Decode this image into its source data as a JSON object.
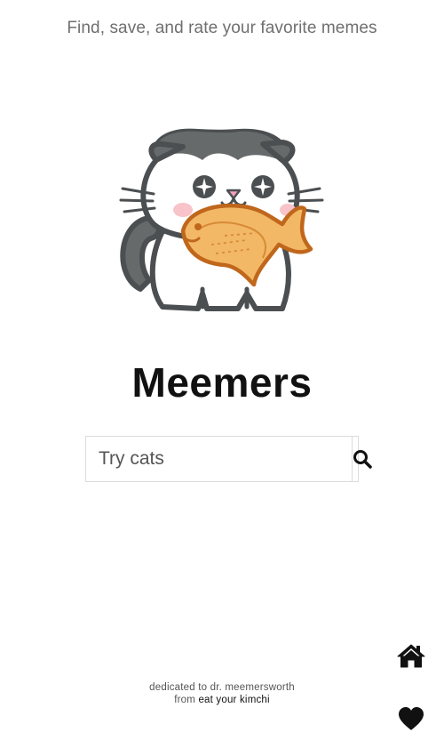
{
  "header": {
    "tagline": "Find, save, and rate your favorite memes"
  },
  "logo": {
    "icon": "cat-eating-taiyaki-icon"
  },
  "app": {
    "title": "Meemers"
  },
  "search": {
    "placeholder": "Try cats",
    "value": "",
    "icon": "search-icon"
  },
  "footer": {
    "dedication": "dedicated to dr. meemersworth",
    "from_label": "from",
    "link_text": "eat your kimchi"
  },
  "nav": {
    "home_icon": "home-icon",
    "favorites_icon": "heart-icon"
  },
  "colors": {
    "cat_gray": "#5a5d5e",
    "cat_outline": "#4b4f51",
    "taiyaki": "#f2b866",
    "taiyaki_outline": "#c0671c",
    "blush": "#f8c3c9",
    "nose": "#f4a0b8"
  }
}
